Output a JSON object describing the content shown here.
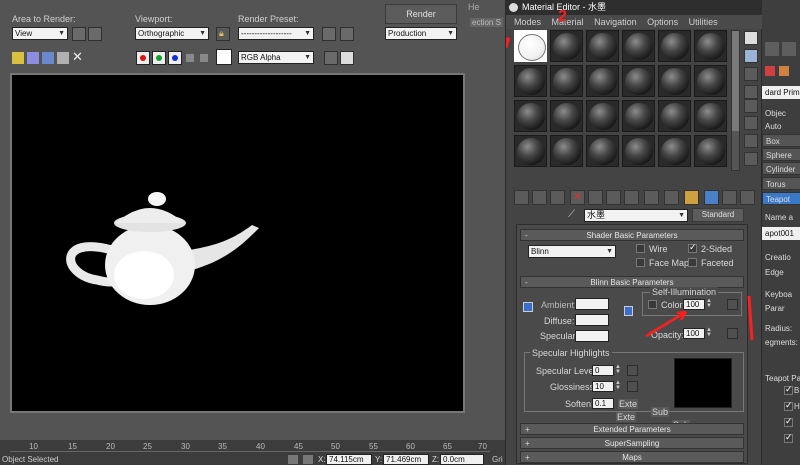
{
  "render_window": {
    "area_label": "Area to Render:",
    "area_value": "View",
    "viewport_label": "Viewport:",
    "viewport_value": "Orthographic",
    "preset_label": "Render Preset:",
    "preset_value": "-------------------",
    "render_button": "Render",
    "mode_value": "Production",
    "channel_value": "RGB Alpha",
    "bg_fragment": "He",
    "selection_fragment": "ection S"
  },
  "timeline": {
    "ticks": [
      "10",
      "15",
      "20",
      "25",
      "30",
      "35",
      "40",
      "45",
      "50",
      "55",
      "60",
      "65",
      "70"
    ],
    "status": "Object Selected",
    "x_label": "X:",
    "x_value": "74.115cm",
    "y_label": "Y:",
    "y_value": "71.469cm",
    "z_label": "Z:",
    "z_value": "0.0cm",
    "grid_fragment": "Gri"
  },
  "material_editor": {
    "title": "Material Editor - 水墨",
    "menu": [
      "Modes",
      "Material",
      "Navigation",
      "Options",
      "Utilities"
    ],
    "material_name": "水墨",
    "material_type": "Standard",
    "shader_rollup": "Shader Basic Parameters",
    "shader_value": "Blinn",
    "wire": "Wire",
    "two_sided": "2-Sided",
    "face_map": "Face Map",
    "faceted": "Faceted",
    "blinn_rollup": "Blinn Basic Parameters",
    "self_illum_title": "Self-Illumination",
    "color_label": "Color",
    "color_value": "100",
    "ambient": "Ambient:",
    "diffuse": "Diffuse:",
    "specular": "Specular:",
    "opacity": "Opacity:",
    "opacity_value": "100",
    "spec_highlights": "Specular Highlights",
    "spec_level": "Specular Level:",
    "spec_level_value": "0",
    "glossiness": "Glossiness:",
    "glossiness_value": "10",
    "soften": "Soften:",
    "soften_value": "0.1",
    "extended_rollup": "Extended Parameters",
    "supersampling_rollup": "SuperSampling",
    "maps_rollup": "Maps",
    "ext_fragment1": "Exte",
    "ext_fragment2": "Exte",
    "sub_fragment1": "Sub",
    "sub_fragment2": "Sub",
    "annotation_1": "1",
    "annotation_2": "2"
  },
  "command_panel": {
    "standard_primitives": "dard Primiti",
    "object_type": "Objec",
    "autogrid": "Auto",
    "box": "Box",
    "sphere": "Sphere",
    "cylinder": "Cylinder",
    "torus": "Torus",
    "teapot": "Teapot",
    "name_and": "Name a",
    "teapot_name": "apot001",
    "creation": "Creatio",
    "edge": "Edge",
    "keyboard": "Keyboa",
    "params": "Parar",
    "radius": "Radius:",
    "segments": "egments:",
    "teapot_parts": "Teapot Pa",
    "b_fragment": "B",
    "h_fragment": "H"
  },
  "colors": {
    "annotation_red": "#ff1e1e",
    "active_slot": "#ffffff",
    "teapot": "#f0f0f0"
  }
}
